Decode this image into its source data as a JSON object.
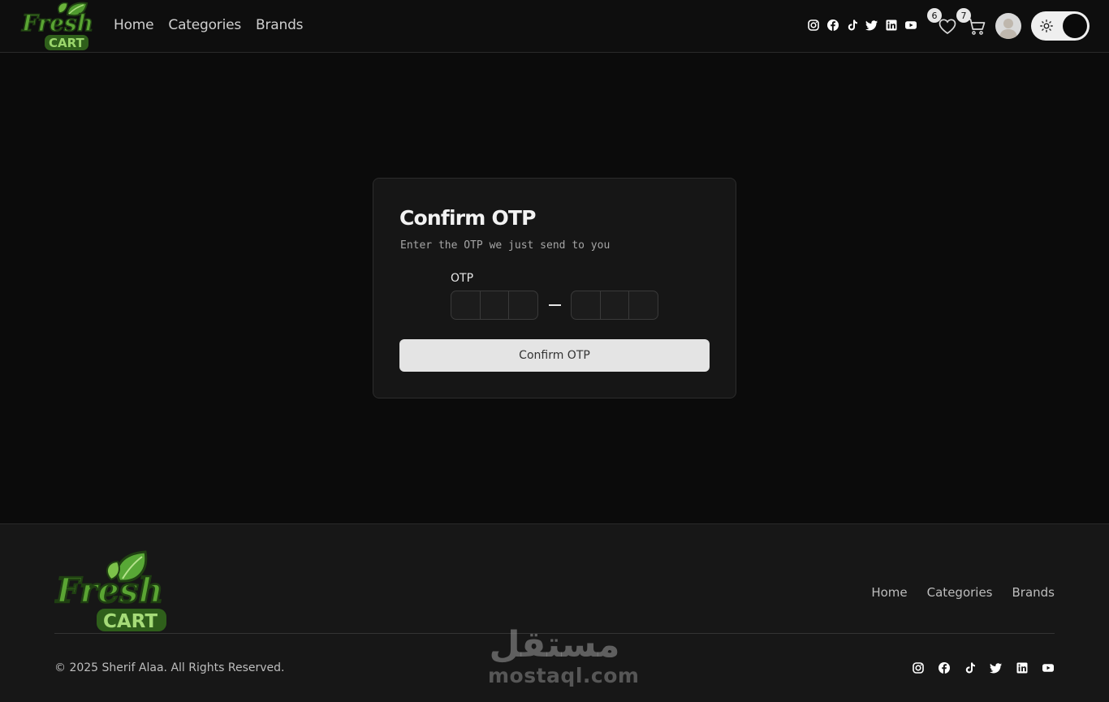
{
  "brand": {
    "name_line1": "Fresh",
    "name_line2": "CART",
    "primary_color": "#4f9a2e",
    "accent_color": "#7cc34a"
  },
  "header": {
    "nav": [
      "Home",
      "Categories",
      "Brands"
    ],
    "social_icons": [
      "instagram-icon",
      "facebook-icon",
      "tiktok-icon",
      "twitter-icon",
      "linkedin-icon",
      "youtube-icon"
    ],
    "wishlist_count": "6",
    "cart_count": "7",
    "theme_toggle": "dark"
  },
  "otp_form": {
    "title": "Confirm OTP",
    "subtitle": "Enter the OTP we just send to you",
    "label": "OTP",
    "slots": [
      "",
      "",
      "",
      "",
      "",
      ""
    ],
    "submit_label": "Confirm OTP"
  },
  "footer": {
    "nav": [
      "Home",
      "Categories",
      "Brands"
    ],
    "copyright": "© 2025 Sherif Alaa. All Rights Reserved.",
    "social_icons": [
      "instagram-icon",
      "facebook-icon",
      "tiktok-icon",
      "twitter-icon",
      "linkedin-icon",
      "youtube-icon"
    ]
  },
  "watermark": {
    "arabic": "مستقل",
    "latin": "mostaql.com"
  }
}
